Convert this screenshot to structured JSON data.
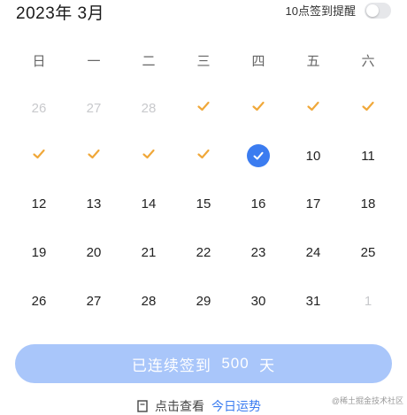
{
  "header": {
    "month_title": "2023年 3月",
    "reminder_label": "10点签到提醒",
    "reminder_enabled": false
  },
  "weekdays": [
    "日",
    "一",
    "二",
    "三",
    "四",
    "五",
    "六"
  ],
  "calendar": {
    "checked_day_count": 9,
    "rows": [
      [
        {
          "text": "26",
          "state": "muted"
        },
        {
          "text": "27",
          "state": "muted"
        },
        {
          "text": "28",
          "state": "muted"
        },
        {
          "text": "",
          "state": "checked"
        },
        {
          "text": "",
          "state": "checked"
        },
        {
          "text": "",
          "state": "checked"
        },
        {
          "text": "",
          "state": "checked"
        }
      ],
      [
        {
          "text": "",
          "state": "checked"
        },
        {
          "text": "",
          "state": "checked"
        },
        {
          "text": "",
          "state": "checked"
        },
        {
          "text": "",
          "state": "checked"
        },
        {
          "text": "",
          "state": "today-checked"
        },
        {
          "text": "10",
          "state": "normal"
        },
        {
          "text": "11",
          "state": "normal"
        }
      ],
      [
        {
          "text": "12",
          "state": "normal"
        },
        {
          "text": "13",
          "state": "normal"
        },
        {
          "text": "14",
          "state": "normal"
        },
        {
          "text": "15",
          "state": "normal"
        },
        {
          "text": "16",
          "state": "normal"
        },
        {
          "text": "17",
          "state": "normal"
        },
        {
          "text": "18",
          "state": "normal"
        }
      ],
      [
        {
          "text": "19",
          "state": "normal"
        },
        {
          "text": "20",
          "state": "normal"
        },
        {
          "text": "21",
          "state": "normal"
        },
        {
          "text": "22",
          "state": "normal"
        },
        {
          "text": "23",
          "state": "normal"
        },
        {
          "text": "24",
          "state": "normal"
        },
        {
          "text": "25",
          "state": "normal"
        }
      ],
      [
        {
          "text": "26",
          "state": "normal"
        },
        {
          "text": "27",
          "state": "normal"
        },
        {
          "text": "28",
          "state": "normal"
        },
        {
          "text": "29",
          "state": "normal"
        },
        {
          "text": "30",
          "state": "normal"
        },
        {
          "text": "31",
          "state": "normal"
        },
        {
          "text": "1",
          "state": "muted"
        }
      ]
    ]
  },
  "streak_button": {
    "prefix": "已连续签到",
    "count": "500",
    "suffix": "天"
  },
  "footer": {
    "prompt": "点击查看",
    "link": "今日运势"
  },
  "watermark": "@稀土掘金技术社区",
  "colors": {
    "accent": "#3b7cf0",
    "check": "#f0a83a",
    "button_bg": "#a9c6fa",
    "muted": "#c8c9cc"
  },
  "icons": {
    "check": "check-icon",
    "today": "check-circle-icon",
    "footer": "document-icon"
  }
}
